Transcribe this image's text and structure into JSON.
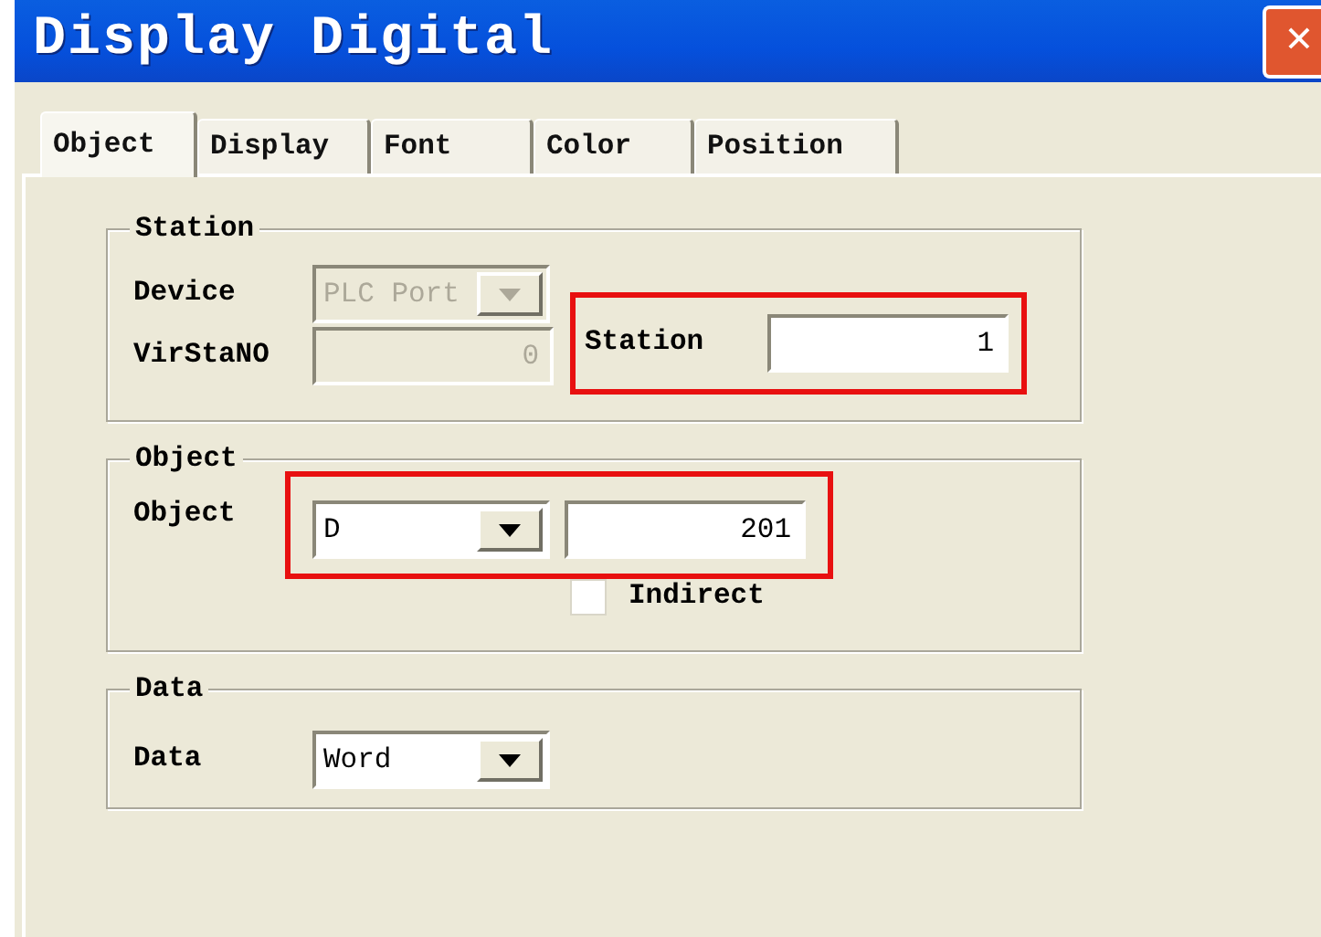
{
  "window": {
    "title": "Display Digital",
    "close_symbol": "✕"
  },
  "tabs": [
    {
      "label": "Object",
      "selected": true
    },
    {
      "label": "Display",
      "selected": false
    },
    {
      "label": "Font",
      "selected": false
    },
    {
      "label": "Color",
      "selected": false
    },
    {
      "label": "Position",
      "selected": false
    }
  ],
  "station_group": {
    "title": "Station",
    "device": {
      "label": "Device",
      "value": "PLC Port",
      "disabled": true
    },
    "virstano": {
      "label": "VirStaNO",
      "value": "0",
      "disabled": true
    },
    "station": {
      "label": "Station",
      "value": "1",
      "disabled": false,
      "highlighted": true
    }
  },
  "object_group": {
    "title": "Object",
    "label": "Object",
    "type": {
      "value": "D",
      "disabled": false
    },
    "address": {
      "value": "201",
      "disabled": false
    },
    "highlighted": true,
    "indirect": {
      "label": "Indirect",
      "checked": false
    }
  },
  "data_group": {
    "title": "Data",
    "label": "Data",
    "type": {
      "value": "Word",
      "disabled": false
    }
  }
}
